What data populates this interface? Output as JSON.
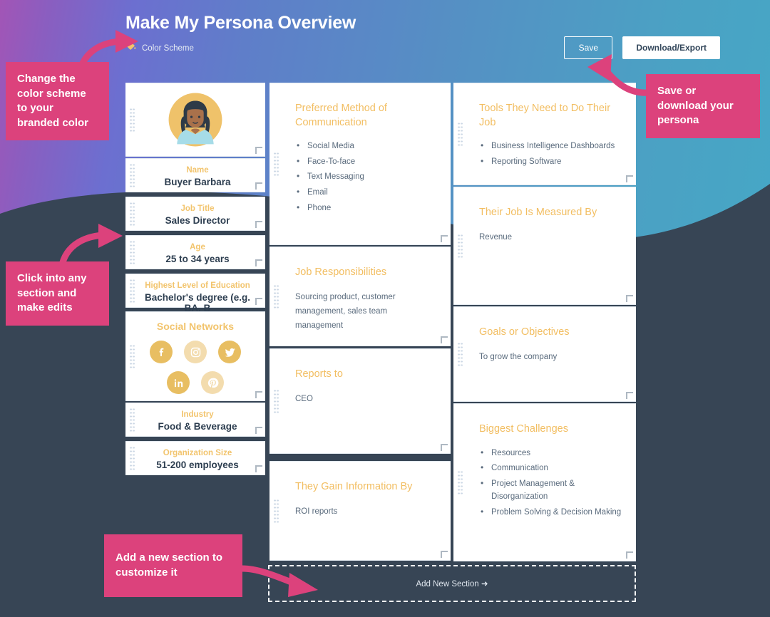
{
  "header": {
    "title": "Make My Persona Overview",
    "color_scheme_label": "Color Scheme",
    "color_scheme_icon": "paint-bucket-icon",
    "save_label": "Save",
    "download_label": "Download/Export"
  },
  "colors": {
    "accent_yellow": "#F2C46D",
    "heading_yellow": "#F2BE62",
    "annotation_pink": "#DC427C",
    "board_navy": "#374555",
    "card_white": "#FFFFFF",
    "body_text": "#5A6B7D",
    "gradient_from": "#A255B6",
    "gradient_to": "#45A8C6"
  },
  "left_column": [
    {
      "type": "avatar",
      "name": "persona-avatar",
      "alt": "Persona avatar illustration"
    },
    {
      "type": "field",
      "label": "Name",
      "value": "Buyer Barbara"
    },
    {
      "type": "field",
      "label": "Job Title",
      "value": "Sales Director"
    },
    {
      "type": "field",
      "label": "Age",
      "value": "25 to 34 years"
    },
    {
      "type": "field",
      "label": "Highest Level of Education",
      "value": "Bachelor's degree (e.g. BA, B"
    },
    {
      "type": "social",
      "label": "Social Networks",
      "networks": [
        {
          "name": "facebook",
          "glyph": "f",
          "active": true
        },
        {
          "name": "instagram",
          "glyph": "instagram",
          "active": false
        },
        {
          "name": "twitter",
          "glyph": "twitter",
          "active": true
        },
        {
          "name": "linkedin",
          "glyph": "in",
          "active": true
        },
        {
          "name": "pinterest",
          "glyph": "P",
          "active": false
        }
      ]
    },
    {
      "type": "field",
      "label": "Industry",
      "value": "Food & Beverage"
    },
    {
      "type": "field",
      "label": "Organization Size",
      "value": "51-200 employees"
    }
  ],
  "middle_column": [
    {
      "title": "Preferred Method of Communication",
      "items": [
        "Social Media",
        "Face-To-face",
        "Text Messaging",
        "Email",
        "Phone"
      ]
    },
    {
      "title": "Job Responsibilities",
      "text": "Sourcing product, customer management, sales team management"
    },
    {
      "title": "Reports to",
      "text": "CEO"
    },
    {
      "title": "They Gain Information By",
      "text": "ROI reports"
    }
  ],
  "right_column": [
    {
      "title": "Tools They Need to Do Their Job",
      "items": [
        "Business Intelligence Dashboards",
        "Reporting Software"
      ]
    },
    {
      "title": "Their Job Is Measured By",
      "text": "Revenue"
    },
    {
      "title": "Goals or Objectives",
      "text": "To grow the company"
    },
    {
      "title": "Biggest Challenges",
      "items": [
        "Resources",
        "Communication",
        "Project Management & Disorganization",
        "Problem Solving & Decision Making"
      ]
    }
  ],
  "add_new_section": {
    "label": "Add New Section ➜"
  },
  "annotations": [
    {
      "id": "anno-color-scheme",
      "text": "Change the color scheme to your branded color"
    },
    {
      "id": "anno-save-download",
      "text": "Save or download your persona"
    },
    {
      "id": "anno-click-section",
      "text": "Click into any section and make edits"
    },
    {
      "id": "anno-add-section",
      "text": "Add a new section to customize it"
    }
  ]
}
